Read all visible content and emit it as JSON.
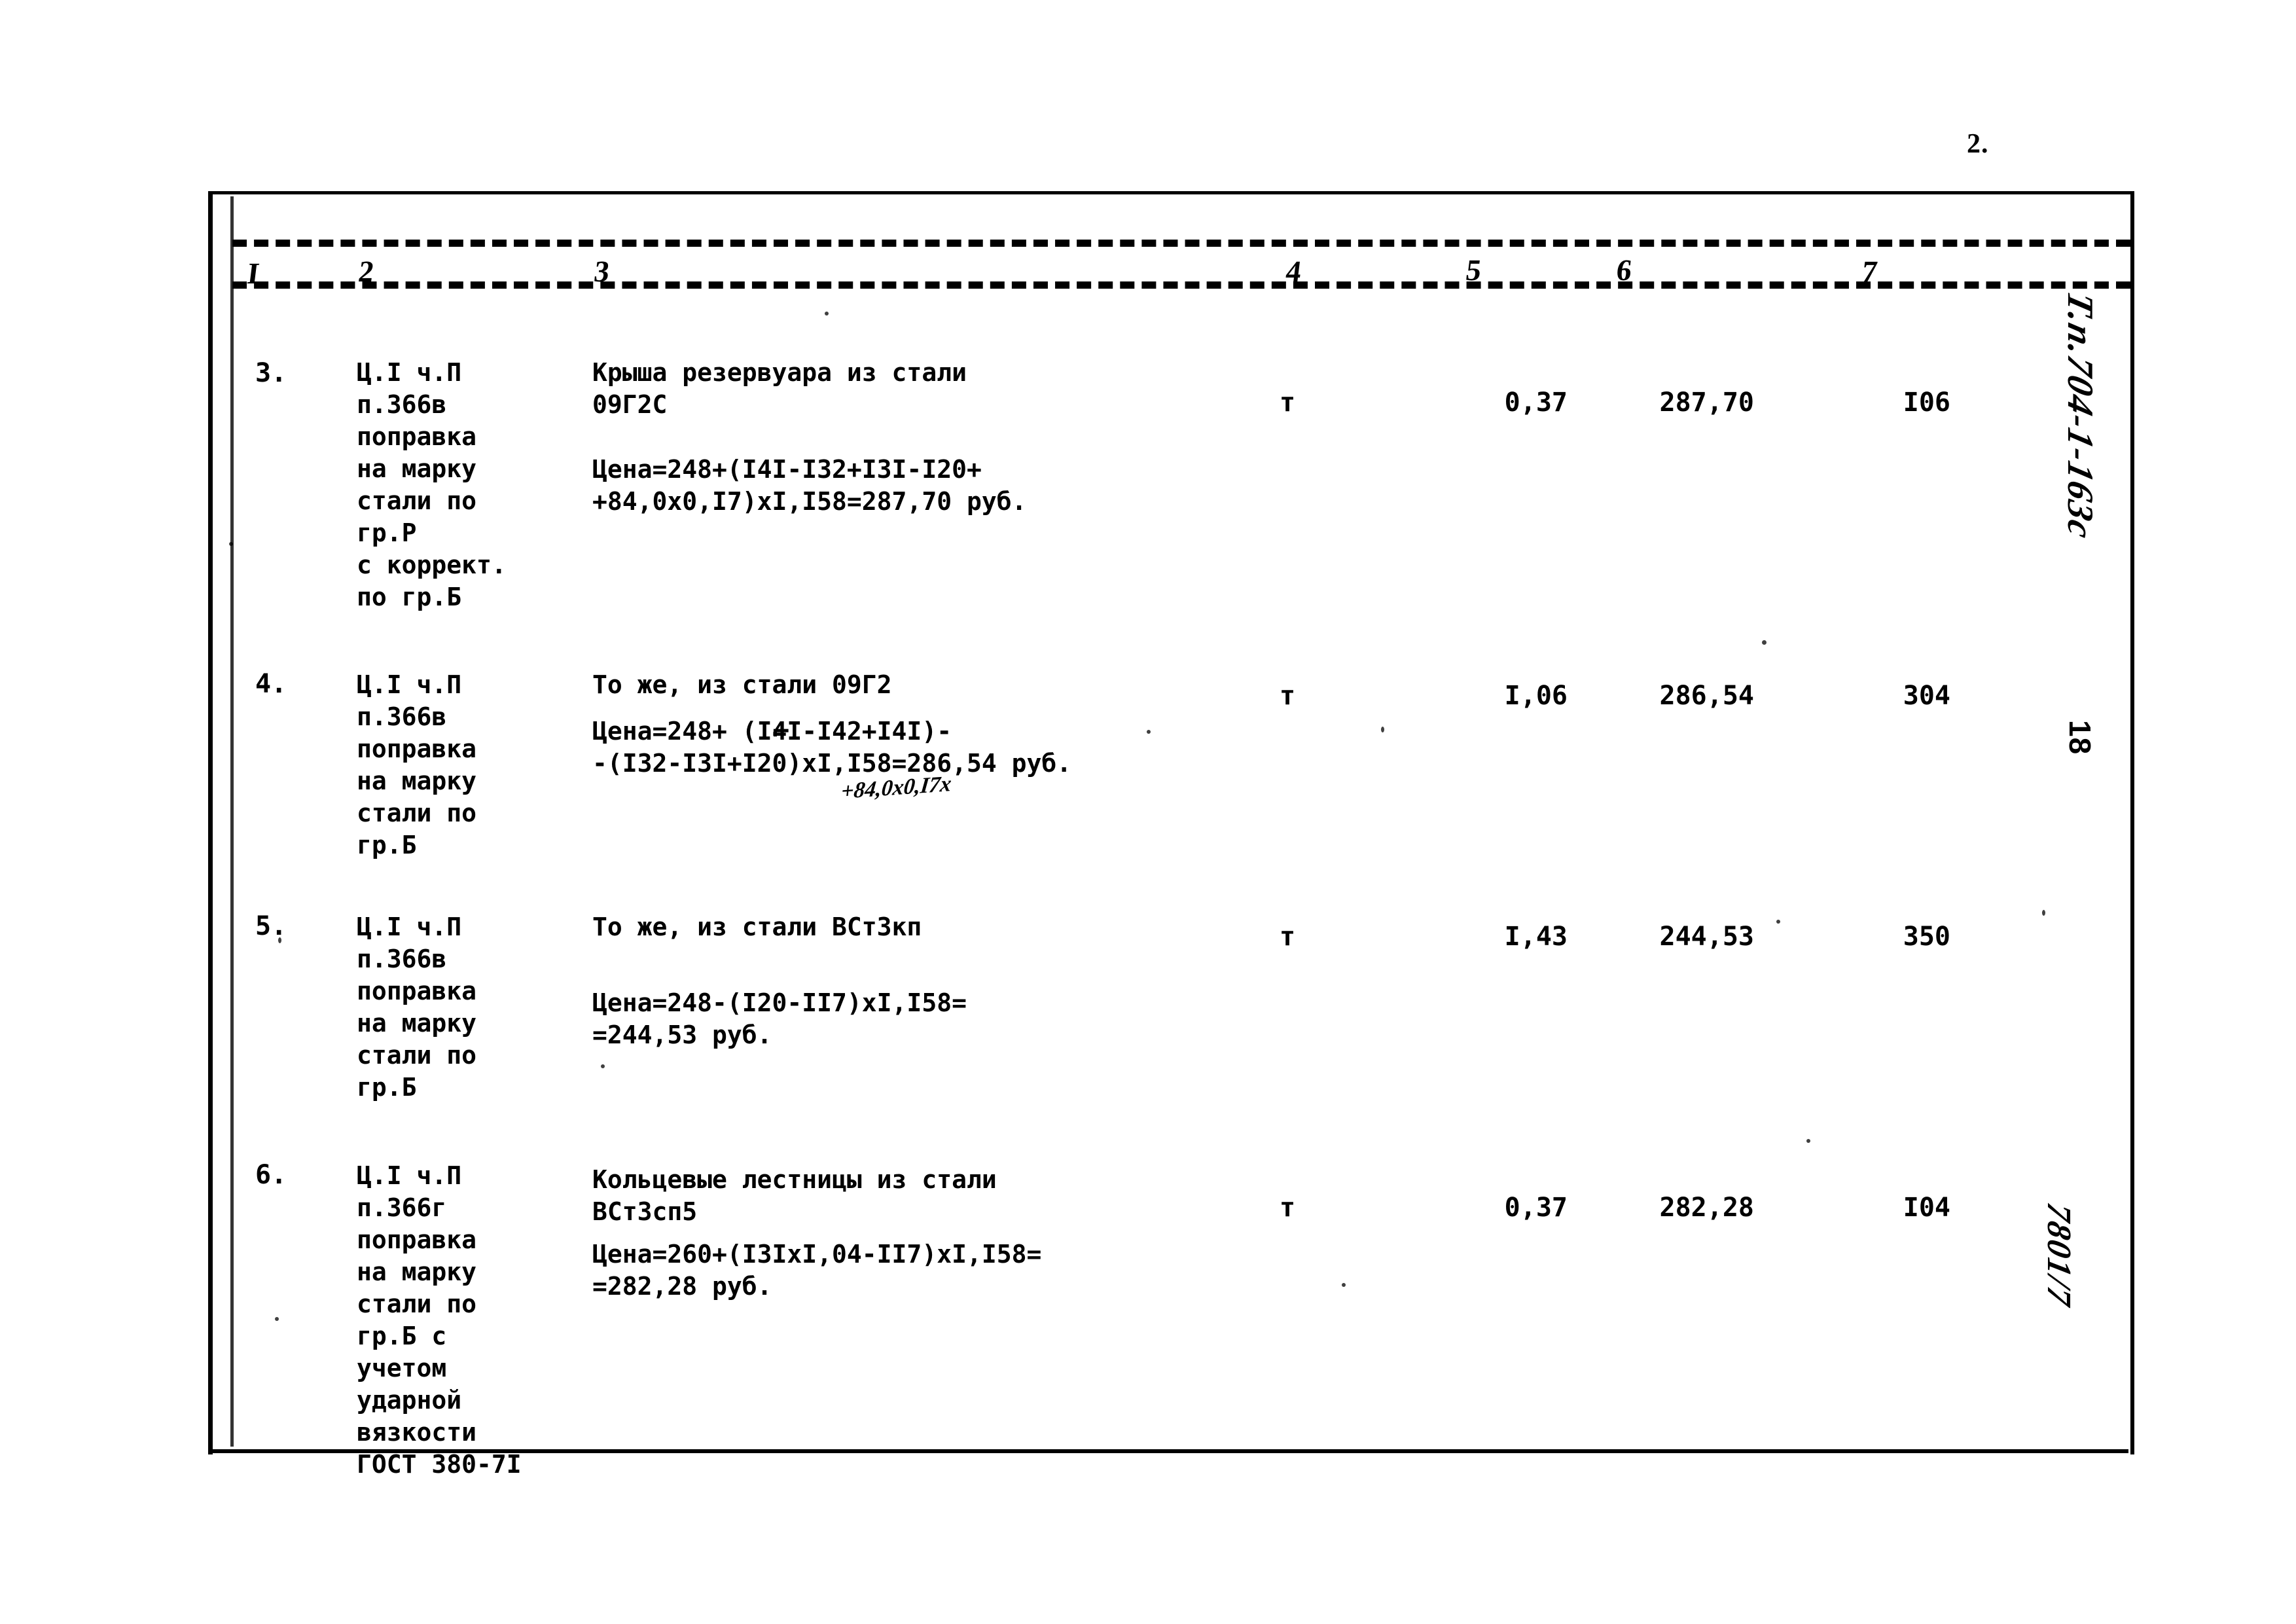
{
  "page": {
    "number": "2."
  },
  "table": {
    "column_numbers": [
      "I",
      "2",
      "3",
      "4",
      "5",
      "6",
      "7"
    ],
    "rows": [
      {
        "no": "3.",
        "justification": "Ц.I ч.П\nп.366в\nпоправка\nна марку\nстали по\nгр.Р\nс коррект.\nпо гр.Б",
        "description_title": "Крыша резервуара из стали\n09Г2С",
        "description_formula": "Цена=248+(I4I-I32+I3I-I20+\n+84,0х0,I7)хI,I58=287,70 руб.",
        "unit": "т",
        "quantity": "0,37",
        "price": "287,70",
        "total": "I06"
      },
      {
        "no": "4.",
        "justification": "Ц.I ч.П\nп.366в\nпоправка\nна марку\nстали по\nгр.Б",
        "description_title": "То же, из стали 09Г2",
        "description_formula": "Цена=248+ (I4I-I42+I4I)-\n-(I32-I3I+I20)хI,I58=286,54 руб.",
        "hand_insert": "+84,0х0,I7х",
        "bracket_glyph": "⌐",
        "unit": "т",
        "quantity": "I,06",
        "price": "286,54",
        "total": "304"
      },
      {
        "no": "5.",
        "justification": "Ц.I ч.П\nп.366в\nпоправка\nна марку\nстали по\nгр.Б",
        "description_title": "То же, из стали ВСт3кп",
        "description_formula": "Цена=248-(I20-II7)хI,I58=\n=244,53 руб.",
        "unit": "т",
        "quantity": "I,43",
        "price": "244,53",
        "total": "350"
      },
      {
        "no": "6.",
        "justification": "Ц.I ч.П\nп.366г\nпоправка\nна марку\nстали по\nгр.Б с\nучетом\nударной\nвязкости\nГОСТ 380-7I",
        "description_title": "Кольцевые лестницы из стали\nВСт3сп5",
        "description_formula": "Цена=260+(I3IхI,04-II7)хI,I58=\n=282,28 руб.",
        "unit": "т",
        "quantity": "0,37",
        "price": "282,28",
        "total": "I04"
      }
    ]
  },
  "margin_notes": {
    "project_code": "Т.п.704-1-163с",
    "sheet_number": "18",
    "archive_code": "7801/7"
  }
}
